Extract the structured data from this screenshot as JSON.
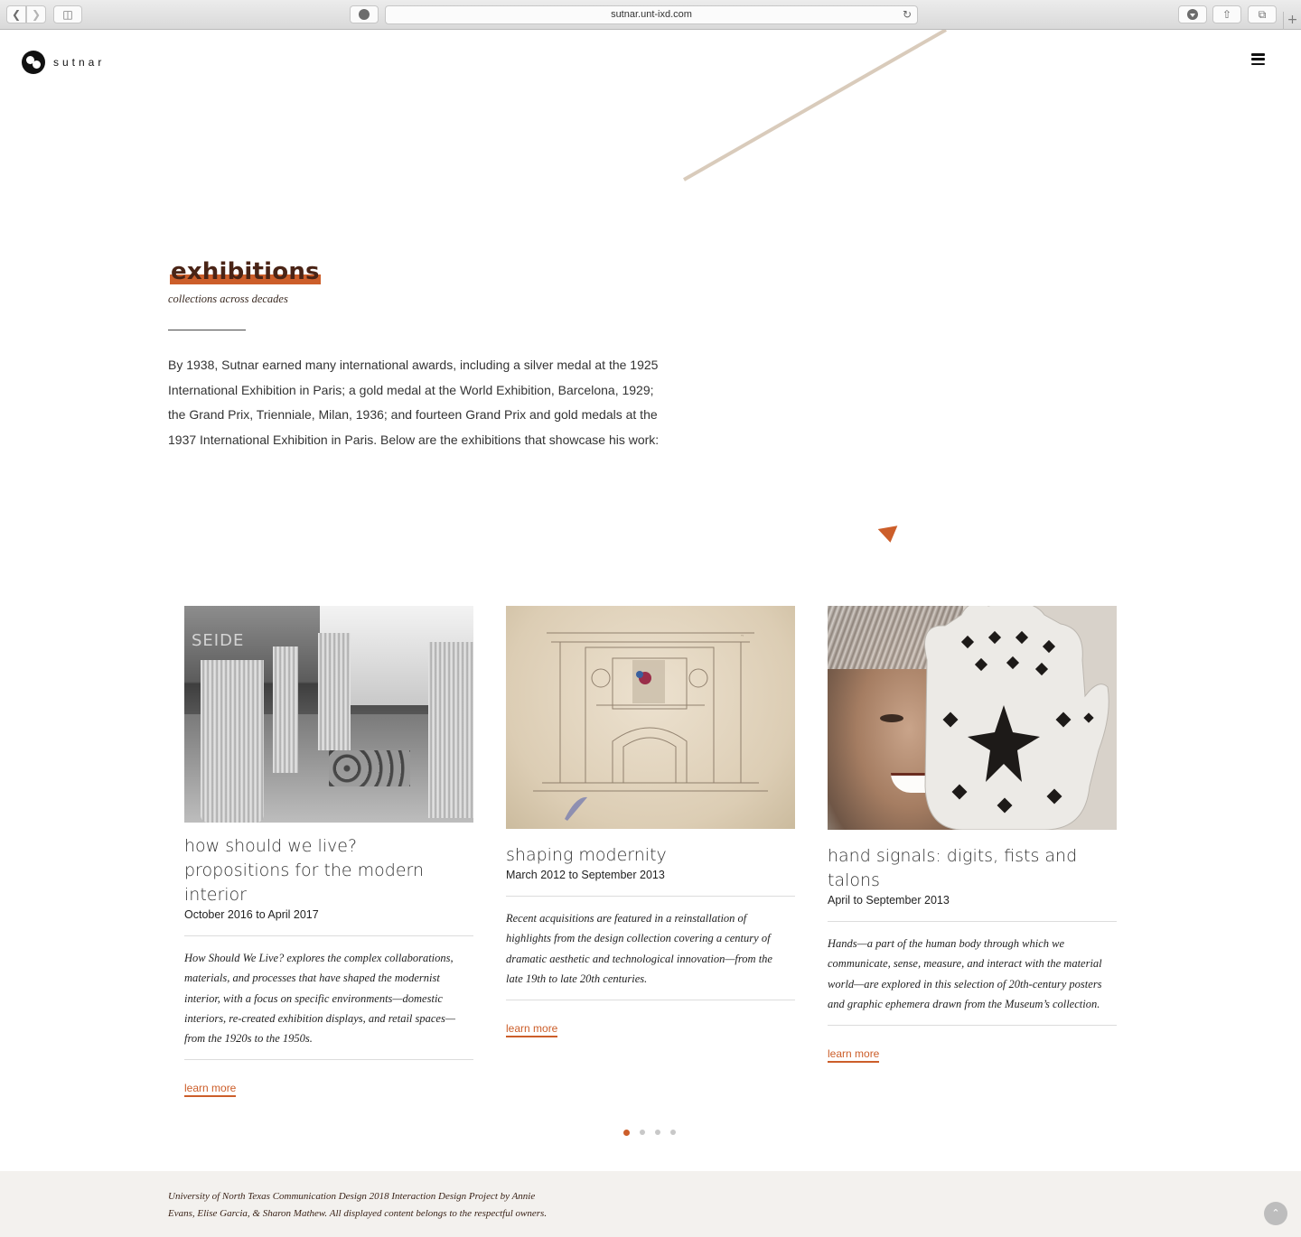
{
  "browser": {
    "url": "sutnar.unt-ixd.com",
    "icons": [
      "back-icon",
      "forward-icon",
      "sidebar-icon",
      "pinterest-icon",
      "reload-icon",
      "download-icon",
      "share-icon",
      "tabs-icon",
      "new-tab-icon"
    ]
  },
  "site": {
    "logo_text": "sutnar",
    "menu_icon": "hamburger-menu-icon"
  },
  "intro": {
    "title": "exhibitions",
    "subtitle": "collections across decades",
    "body": "By 1938, Sutnar earned many international awards, including a silver medal at the 1925 International Exhibition in Paris; a gold medal at the World Exhibition, Barcelona, 1929; the Grand Prix, Trienniale, Milan, 1936; and fourteen Grand Prix and gold medals at the 1937 International Exhibition in Paris. Below are the exhibitions that showcase his work:"
  },
  "cards": [
    {
      "title": "how should we live? propositions for the modern interior",
      "date": "October 2016 to April 2017",
      "description": "How Should We Live? explores the complex collaborations, materials, and processes that have shaped the modernist interior, with a focus on specific environments—domestic interiors, re-created exhibition displays, and retail spaces—from the 1920s to the 1950s.",
      "link_label": "learn more",
      "image_sign": "SEIDE"
    },
    {
      "title": "shaping modernity",
      "date": "March 2012 to September 2013",
      "description": "Recent acquisitions are featured in a reinstallation of highlights from the design collection covering a century of dramatic aesthetic and technological innovation—from the late 19th to late 20th centuries.",
      "link_label": "learn more"
    },
    {
      "title": "hand signals: digits, fists and talons",
      "date": "April to September 2013",
      "description": "Hands—a part of the human body through which we communicate, sense, measure, and interact with the material world—are explored in this selection of 20th-century posters and graphic ephemera drawn from the Museum’s collection.",
      "link_label": "learn more"
    }
  ],
  "carousel": {
    "pages": 4,
    "active_index": 0
  },
  "footer": {
    "text": "University of North Texas Communication Design 2018 Interaction Design Project by Annie Evans, Elise Garcia, & Sharon Mathew. All displayed content belongs to the respectful owners.",
    "back_to_top_icon": "chevron-up-icon"
  },
  "colors": {
    "accent": "#cc5e2a",
    "title": "#4a2416",
    "diagonal_line": "#d9cbbb",
    "footer_bg": "#f3f1ee"
  }
}
